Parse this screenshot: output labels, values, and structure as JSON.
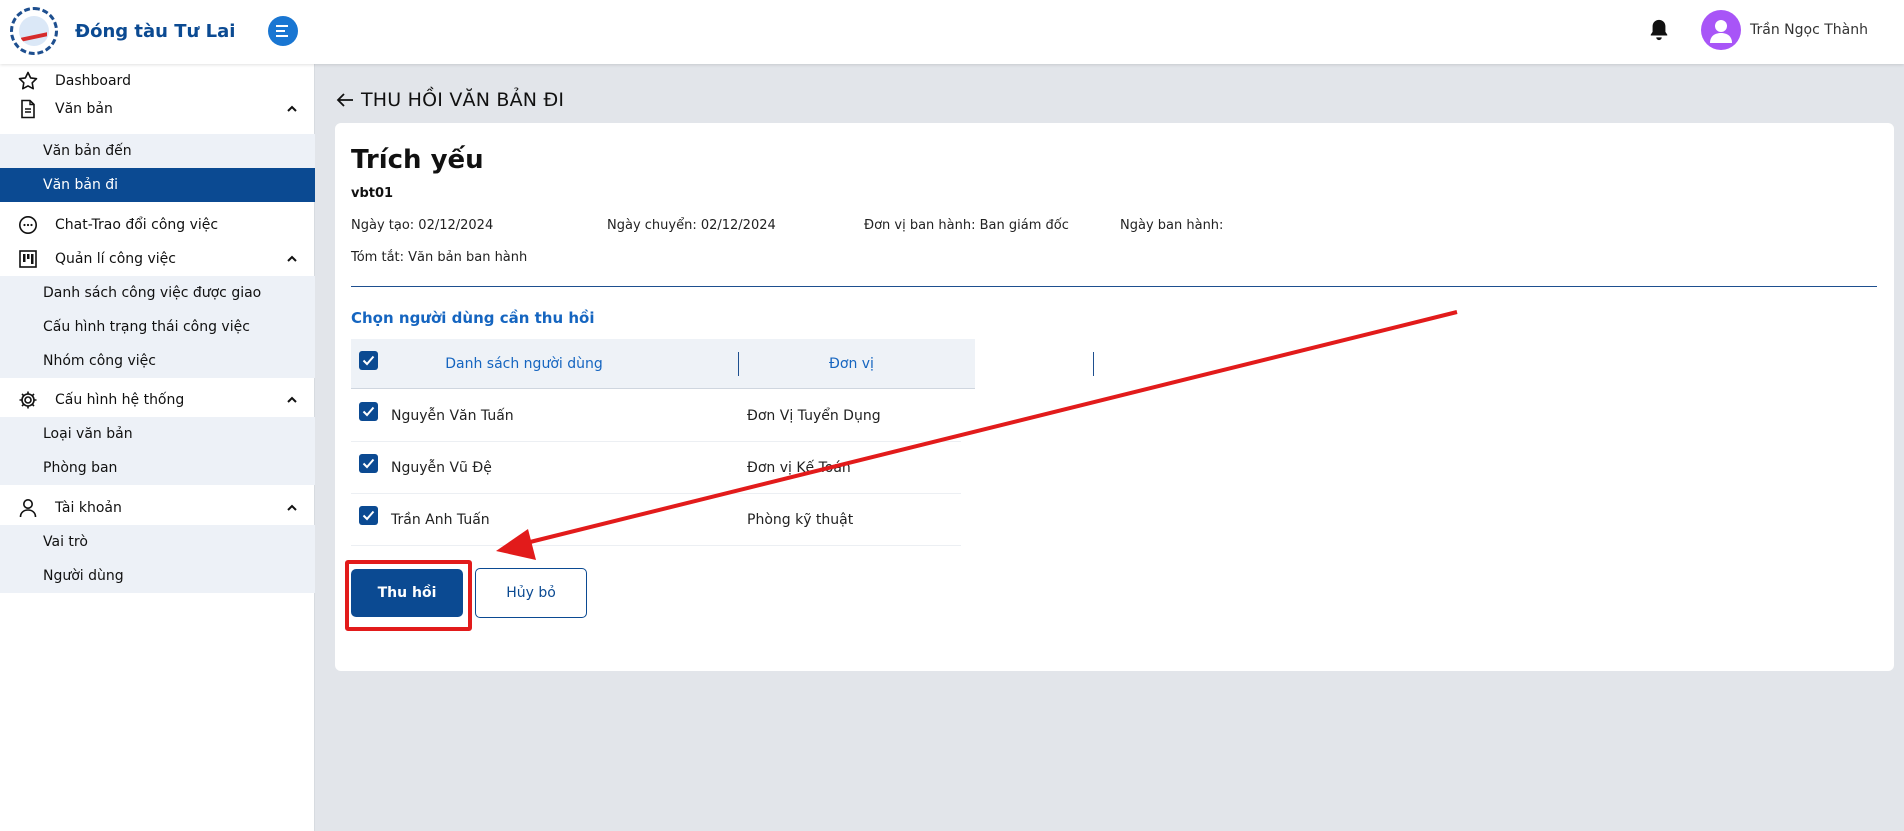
{
  "app": {
    "brand_name": "Đóng tàu Tư Lai"
  },
  "user": {
    "name": "Trần Ngọc Thành"
  },
  "sidebar": {
    "dashboard": "Dashboard",
    "van_ban": "Văn bản",
    "van_ban_den": "Văn bản đến",
    "van_ban_di": "Văn bản đi",
    "chat": "Chat-Trao đổi công việc",
    "quan_li_cong_viec": "Quản lí công việc",
    "danh_sach_cv": "Danh sách công việc được giao",
    "cau_hinh_trang_thai": "Cấu hình trạng thái công việc",
    "nhom_cong_viec": "Nhóm công việc",
    "cau_hinh_he_thong": "Cấu hình hệ thống",
    "loai_van_ban": "Loại văn bản",
    "phong_ban": "Phòng ban",
    "tai_khoan": "Tài khoản",
    "vai_tro": "Vai trò",
    "nguoi_dung": "Người dùng"
  },
  "page": {
    "title": "THU HỒI VĂN BẢN ĐI"
  },
  "document": {
    "heading": "Trích yếu",
    "code": "vbt01",
    "ngay_tao": "Ngày tạo: 02/12/2024",
    "ngay_chuyen": "Ngày chuyển: 02/12/2024",
    "don_vi_ban_hanh": "Đơn vị ban hành: Ban giám đốc",
    "ngay_ban_hanh": "Ngày ban hành:",
    "tom_tat": "Tóm tắt: Văn bản ban hành"
  },
  "recall": {
    "section_title": "Chọn người dùng cần thu hồi",
    "col_users": "Danh sách người dùng",
    "col_unit": "Đơn vị",
    "rows": [
      {
        "name": "Nguyễn Văn Tuấn",
        "unit": "Đơn Vị Tuyển Dụng",
        "checked": true
      },
      {
        "name": "Nguyễn Vũ Đệ",
        "unit": "Đơn vị Kế Toán",
        "checked": true
      },
      {
        "name": "Trần Anh Tuấn",
        "unit": "Phòng kỹ thuật",
        "checked": true
      }
    ],
    "select_all_checked": true
  },
  "actions": {
    "submit": "Thu hồi",
    "cancel": "Hủy bỏ"
  },
  "colors": {
    "primary": "#0b4a92",
    "link": "#1565c0",
    "annotation": "#e21b1b",
    "avatar": "#a855f7"
  }
}
